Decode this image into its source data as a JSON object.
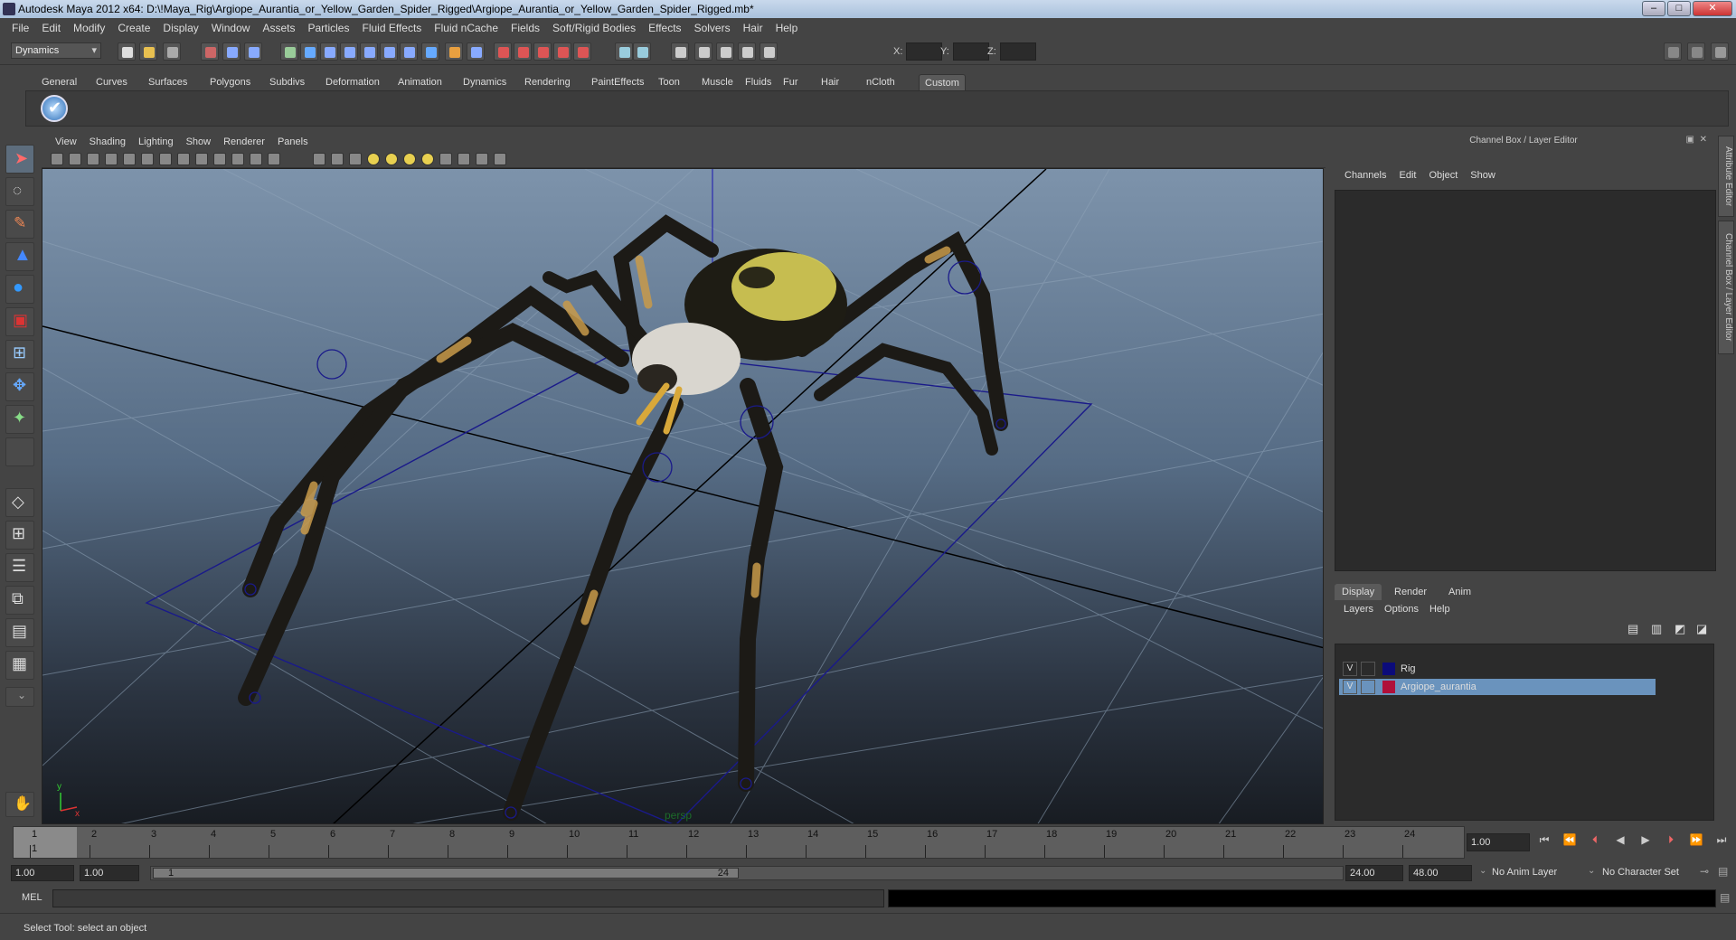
{
  "window": {
    "title": "Autodesk Maya 2012 x64: D:\\!Maya_Rig\\Argiope_Aurantia_or_Yellow_Garden_Spider_Rigged\\Argiope_Aurantia_or_Yellow_Garden_Spider_Rigged.mb*"
  },
  "menubar": [
    "File",
    "Edit",
    "Modify",
    "Create",
    "Display",
    "Window",
    "Assets",
    "Particles",
    "Fluid Effects",
    "Fluid nCache",
    "Fields",
    "Soft/Rigid Bodies",
    "Effects",
    "Solvers",
    "Hair",
    "Help"
  ],
  "statusline": {
    "mode": "Dynamics",
    "x_label": "X:",
    "y_label": "Y:",
    "z_label": "Z:"
  },
  "shelf_tabs": [
    "General",
    "Curves",
    "Surfaces",
    "Polygons",
    "Subdivs",
    "Deformation",
    "Animation",
    "Dynamics",
    "Rendering",
    "PaintEffects",
    "Toon",
    "Muscle",
    "Fluids",
    "Fur",
    "Hair",
    "nCloth",
    "Custom"
  ],
  "shelf_active": "Custom",
  "viewport": {
    "menu": [
      "View",
      "Shading",
      "Lighting",
      "Show",
      "Renderer",
      "Panels"
    ],
    "camera_label": "persp"
  },
  "channel_box": {
    "header": "Channel Box / Layer Editor",
    "menu": [
      "Channels",
      "Edit",
      "Object",
      "Show"
    ]
  },
  "layer_editor": {
    "tabs": [
      "Display",
      "Render",
      "Anim"
    ],
    "active_tab": "Display",
    "menu": [
      "Layers",
      "Options",
      "Help"
    ],
    "layers": [
      {
        "visible": "V",
        "name": "Rig",
        "color": "#0b0b7a",
        "selected": false
      },
      {
        "visible": "V",
        "name": "Argiope_aurantia",
        "color": "#b0103a",
        "selected": true
      }
    ]
  },
  "side_tabs": [
    "Attribute Editor",
    "Channel Box / Layer Editor"
  ],
  "timeslider": {
    "frames": [
      "1",
      "2",
      "3",
      "4",
      "5",
      "6",
      "7",
      "8",
      "9",
      "10",
      "11",
      "12",
      "13",
      "14",
      "15",
      "16",
      "17",
      "18",
      "19",
      "20",
      "21",
      "22",
      "23",
      "24"
    ],
    "current_marker": "1",
    "current_frame": "1.00"
  },
  "range": {
    "start": "1.00",
    "playback_start": "1.00",
    "slider_start": "1",
    "slider_end": "24",
    "playback_end": "24.00",
    "end": "48.00",
    "anim_layer": "No Anim Layer",
    "character_set": "No Character Set"
  },
  "command": {
    "label": "MEL"
  },
  "helpline": {
    "text": "Select Tool: select an object"
  }
}
